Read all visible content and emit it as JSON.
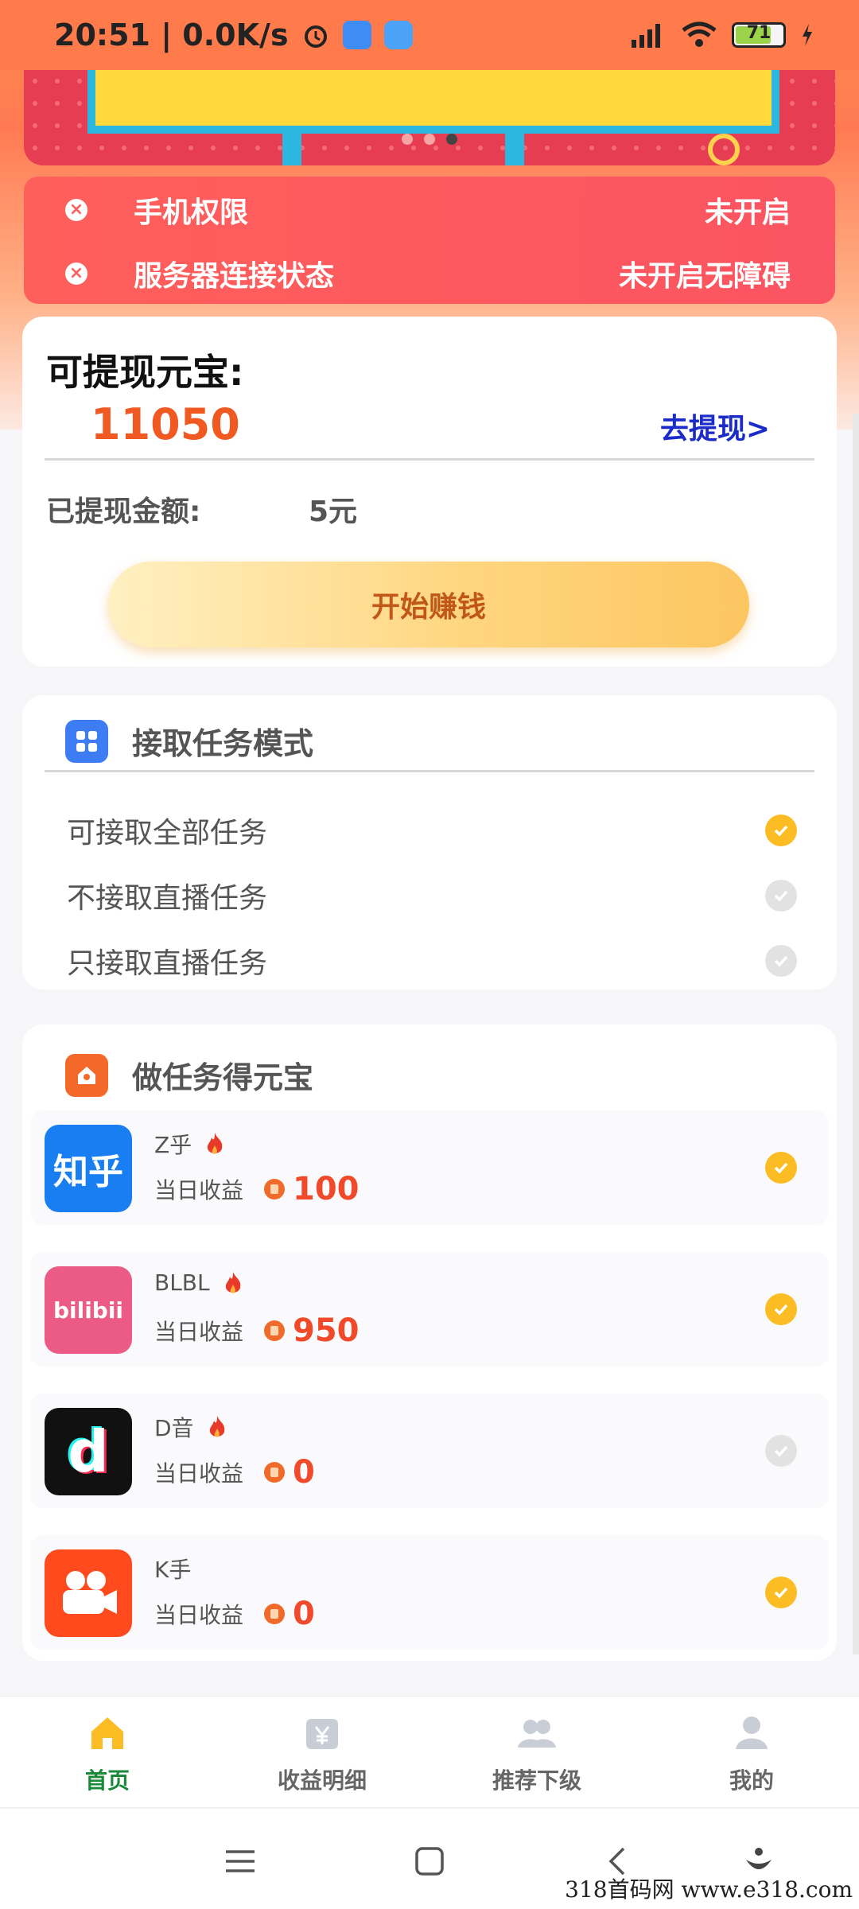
{
  "statusbar": {
    "time_speed": "20:51 | 0.0K/s",
    "battery": "71"
  },
  "status_panel": {
    "rows": [
      {
        "label": "手机权限",
        "value": "未开启"
      },
      {
        "label": "服务器连接状态",
        "value": "未开启无障碍"
      }
    ]
  },
  "withdraw": {
    "title": "可提现元宝:",
    "amount": "11050",
    "link": "去提现>",
    "withdrawn_label": "已提现金额:",
    "withdrawn_value": "5元",
    "start_button": "开始赚钱"
  },
  "mode": {
    "title": "接取任务模式",
    "items": [
      {
        "label": "可接取全部任务",
        "checked": true
      },
      {
        "label": "不接取直播任务",
        "checked": false
      },
      {
        "label": "只接取直播任务",
        "checked": false
      }
    ]
  },
  "tasks": {
    "title": "做任务得元宝",
    "earn_label": "当日收益",
    "items": [
      {
        "name": "Z乎",
        "icon_text": "知乎",
        "amount": "100",
        "hot": true,
        "checked": true
      },
      {
        "name": "BLBL",
        "icon_text": "bilibii",
        "amount": "950",
        "hot": true,
        "checked": true
      },
      {
        "name": "D音",
        "icon_text": "d",
        "amount": "0",
        "hot": true,
        "checked": false
      },
      {
        "name": "K手",
        "icon_text": "",
        "amount": "0",
        "hot": false,
        "checked": true
      }
    ]
  },
  "tabbar": {
    "tabs": [
      {
        "label": "首页",
        "icon": "home-icon",
        "active": true
      },
      {
        "label": "收益明细",
        "icon": "earnings-icon",
        "active": false
      },
      {
        "label": "推荐下级",
        "icon": "referral-icon",
        "active": false
      },
      {
        "label": "我的",
        "icon": "profile-icon",
        "active": false
      }
    ]
  },
  "watermark": "318首码网  www.e318.com",
  "colors": {
    "accent_orange": "#f05a22",
    "link_blue": "#1a2bc9",
    "check_yellow": "#fbbd23",
    "active_tab": "#1a8a3a"
  }
}
